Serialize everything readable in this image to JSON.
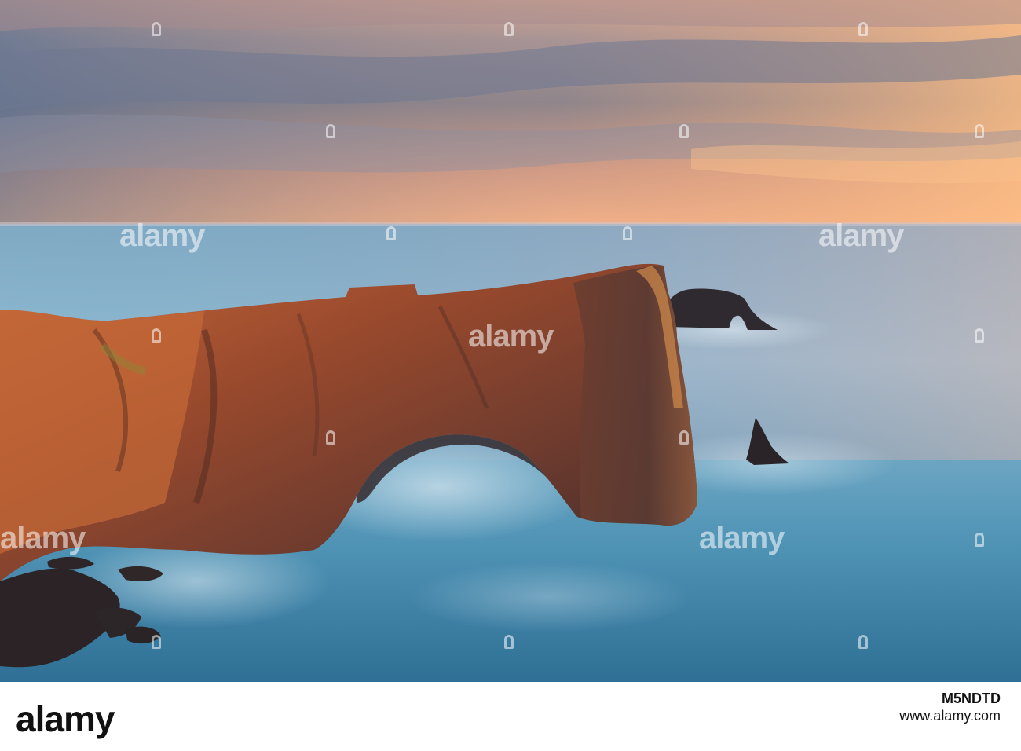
{
  "photo": {
    "subject": "sea-arch-at-sunset",
    "colors": {
      "sky_top": "#5d6b82",
      "sky_glow": "#f3a676",
      "horizon": "#f7b98d",
      "sea": "#4d8fae",
      "sea_light": "#a9cde0",
      "rock_lit": "#b4562f",
      "rock_dark": "#3a2620"
    }
  },
  "watermark": {
    "text": "alamy"
  },
  "footer": {
    "logo": "alamy",
    "image_code": "M5NDTD",
    "url": "www.alamy.com"
  }
}
